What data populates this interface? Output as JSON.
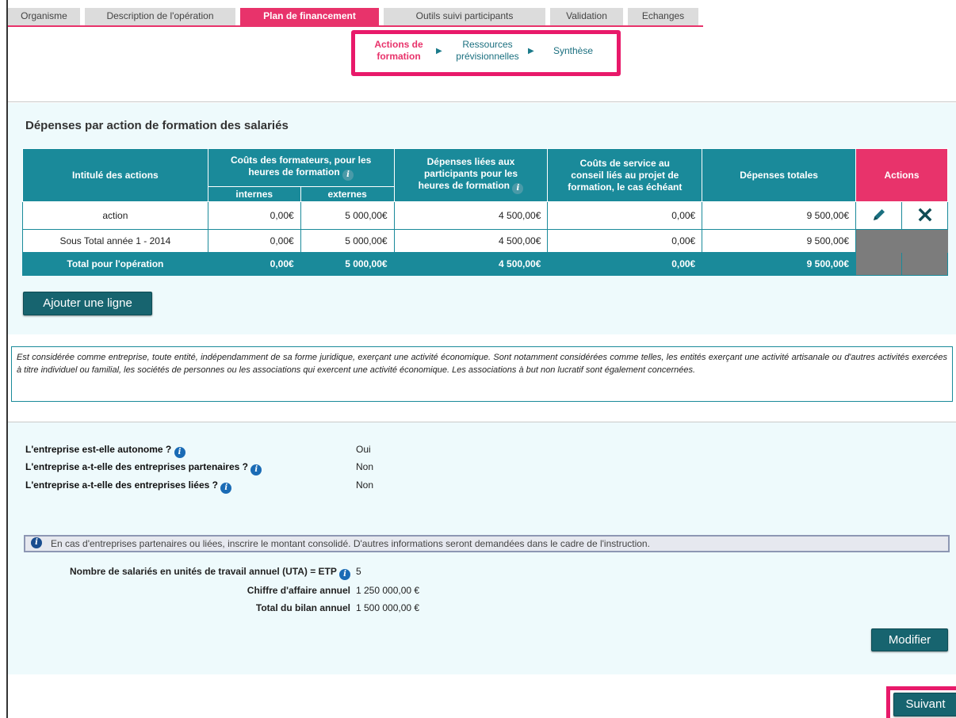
{
  "tabs": [
    {
      "label": "Organisme",
      "active": false
    },
    {
      "label": "Description de l'opération",
      "active": false
    },
    {
      "label": "Plan de financement",
      "active": true
    },
    {
      "label": "Outils suivi participants",
      "active": false
    },
    {
      "label": "Validation",
      "active": false
    },
    {
      "label": "Echanges",
      "active": false
    }
  ],
  "stepper": {
    "step1_line1": "Actions de",
    "step1_line2": "formation",
    "step2_line1": "Ressources",
    "step2_line2": "prévisionnelles",
    "step3": "Synthèse"
  },
  "expenses": {
    "title": "Dépenses par action de formation des salariés",
    "headers": {
      "intitule": "Intitulé des actions",
      "couts_formateurs_l1": "Coûts des formateurs, pour les",
      "couts_formateurs_l2": "heures de formation",
      "internes": "internes",
      "externes": "externes",
      "depenses_participants_l1": "Dépenses liées aux",
      "depenses_participants_l2": "participants pour les",
      "depenses_participants_l3": "heures de formation",
      "couts_service_l1": "Coûts de service au",
      "couts_service_l2": "conseil liés au projet de",
      "couts_service_l3": "formation, le cas échéant",
      "depenses_totales": "Dépenses totales",
      "actions": "Actions"
    },
    "rows": [
      {
        "label": "action",
        "internes": "0,00€",
        "externes": "5 000,00€",
        "participants": "4 500,00€",
        "service": "0,00€",
        "total": "9 500,00€"
      }
    ],
    "subtotal": {
      "label": "Sous Total année 1 - 2014",
      "internes": "0,00€",
      "externes": "5 000,00€",
      "participants": "4 500,00€",
      "service": "0,00€",
      "total": "9 500,00€"
    },
    "total": {
      "label": "Total pour l'opération",
      "internes": "0,00€",
      "externes": "5 000,00€",
      "participants": "4 500,00€",
      "service": "0,00€",
      "total": "9 500,00€"
    },
    "add_button": "Ajouter une ligne"
  },
  "note": "Est considérée comme entreprise, toute entité, indépendamment de sa forme juridique, exerçant une activité économique. Sont notamment considérées comme telles, les entités exerçant une activité artisanale ou d'autres activités exercées à titre individuel ou familial, les sociétés de personnes ou les associations qui exercent une activité économique. Les associations à but non lucratif sont également concernées.",
  "company": {
    "q_autonome": "L'entreprise est-elle autonome ?",
    "a_autonome": "Oui",
    "q_partenaires": "L'entreprise a-t-elle des entreprises partenaires ?",
    "a_partenaires": "Non",
    "q_liees": "L'entreprise a-t-elle des entreprises liées ?",
    "a_liees": "Non",
    "info_bar": "En cas d'entreprises partenaires ou liées, inscrire le montant consolidé. D'autres informations seront demandées dans le cadre de l'instruction.",
    "uta_label": "Nombre de salariés en unités de travail annuel (UTA) = ETP",
    "uta_value": "5",
    "ca_label": "Chiffre d'affaire annuel",
    "ca_value": "1 250 000,00 €",
    "bilan_label": "Total du bilan annuel",
    "bilan_value": "1 500 000,00 €",
    "modify_button": "Modifier"
  },
  "next_button": "Suivant",
  "icons": {
    "info": "i",
    "edit": "pencil-icon",
    "delete": "close-icon"
  }
}
